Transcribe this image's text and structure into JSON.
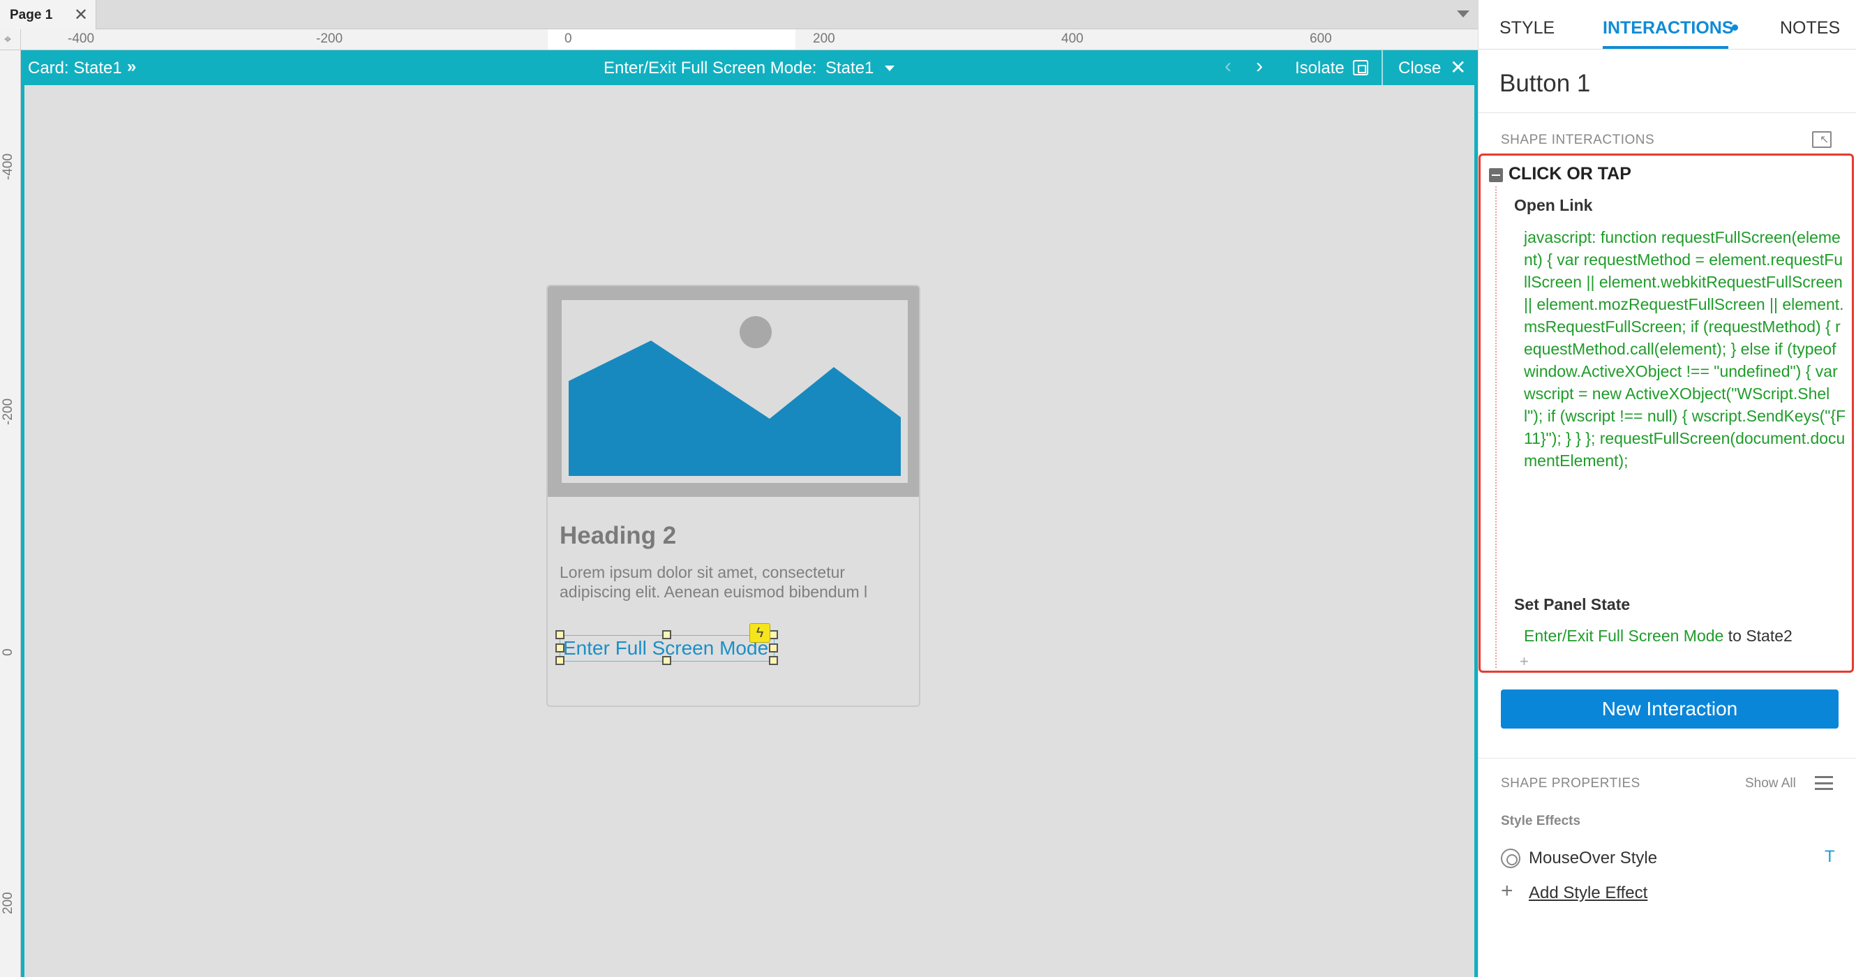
{
  "tabs": {
    "page_tab_label": "Page 1",
    "close_glyph": "✕"
  },
  "ruler": {
    "horizontal_labels": [
      "-400",
      "-200",
      "0",
      "200",
      "400",
      "600"
    ],
    "vertical_labels": [
      "-400",
      "-200",
      "0",
      "200"
    ]
  },
  "frame_header": {
    "card_title": "Card: State1",
    "card_chevron": "»",
    "state_label": "Enter/Exit Full Screen Mode:",
    "state_value": "State1",
    "prev_glyph": "‹",
    "next_glyph": "›",
    "isolate_label": "Isolate",
    "close_label": "Close",
    "close_glyph": "✕"
  },
  "card": {
    "heading": "Heading 2",
    "body": "Lorem ipsum dolor sit amet, consectetur adipiscing elit. Aenean euismod bibendum l",
    "button_label": "Enter Full Screen Mode",
    "lightning_glyph": "ϟ"
  },
  "panel": {
    "tabs": {
      "style": "STYLE",
      "interactions": "INTERACTIONS",
      "notes": "NOTES"
    },
    "shape_name": "Button 1",
    "shape_interactions_title": "SHAPE INTERACTIONS",
    "interaction": {
      "event": "CLICK OR TAP",
      "action1_title": "Open Link",
      "action1_code": "javascript: function requestFullScreen(element) { var requestMethod = element.requestFullScreen || element.webkitRequestFullScreen || element.mozRequestFullScreen || element.msRequestFullScreen; if (requestMethod) { requestMethod.call(element); } else if (typeof window.ActiveXObject !== \"undefined\") { var wscript = new ActiveXObject(\"WScript.Shell\"); if (wscript !== null) { wscript.SendKeys(\"{F11}\"); } } }; requestFullScreen(document.documentElement);",
      "action2_title": "Set Panel State",
      "action2_target": "Enter/Exit Full Screen Mode",
      "action2_to": "to",
      "action2_state": "State2",
      "add_glyph": "+"
    },
    "new_interaction": "New Interaction",
    "shape_properties_title": "SHAPE PROPERTIES",
    "show_all": "Show All",
    "style_effects_title": "Style Effects",
    "mouseover_label": "MouseOver Style",
    "mouseover_badge": "T",
    "add_style_effect": "Add Style Effect",
    "add_style_glyph": "+"
  },
  "icons": {
    "page_tab_close": "close-icon",
    "corner": "crosshair-icon",
    "isolate": "isolate-icon",
    "lightning": "lightning-icon",
    "collapse": "minus-icon",
    "shape_interactions": "select-pointer-icon",
    "mouseover": "target-icon",
    "hamburger": "menu-icon"
  },
  "colors": {
    "accent_teal": "#11b0c0",
    "interactions_blue": "#0f8bd6",
    "code_green": "#1f9c2a",
    "highlight_red": "#e53b2f",
    "button_blue": "#0a86d9",
    "image_blue": "#1789bf"
  }
}
